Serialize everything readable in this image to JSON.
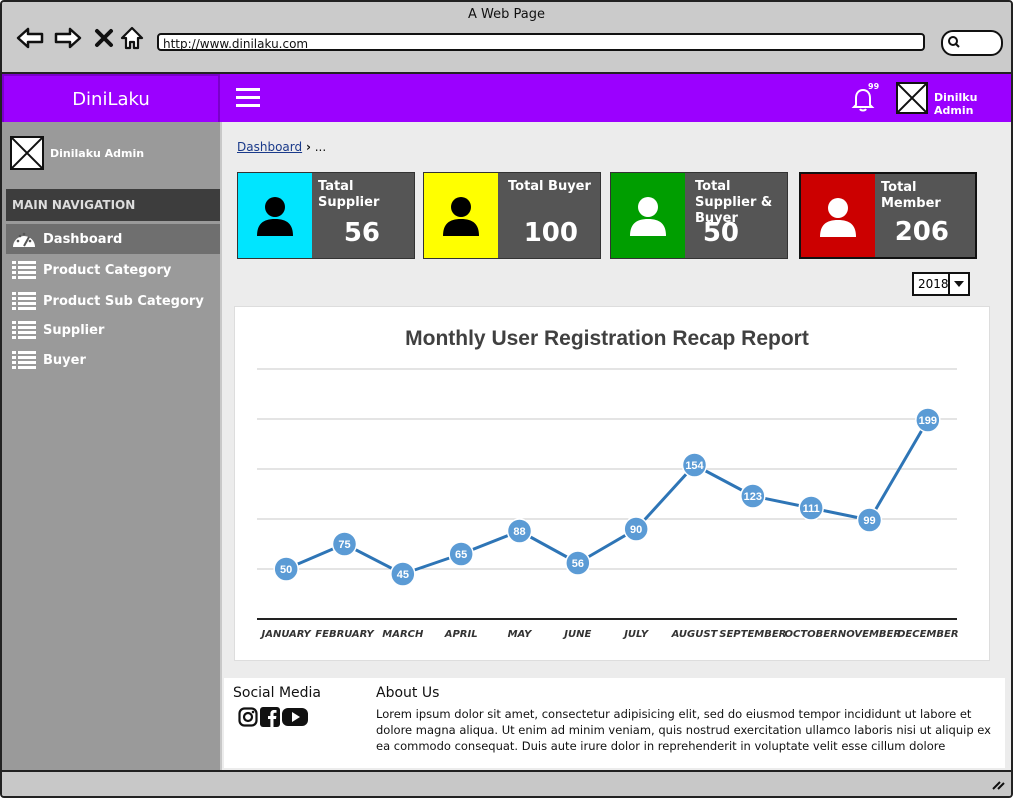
{
  "browser": {
    "window_title": "A Web Page",
    "url": "http://www.dinilaku.com"
  },
  "topbar": {
    "brand": "DiniLaku",
    "notification_count": "99",
    "user_name": "Dinilku Admin"
  },
  "sidebar": {
    "user_name": "Dinilaku Admin",
    "section_title": "MAIN NAVIGATION",
    "items": [
      {
        "label": "Dashboard",
        "icon": "dashboard-gauge-icon",
        "active": true
      },
      {
        "label": "Product Category",
        "icon": "list-icon"
      },
      {
        "label": "Product Sub Category",
        "icon": "list-icon"
      },
      {
        "label": "Supplier",
        "icon": "list-icon"
      },
      {
        "label": "Buyer",
        "icon": "list-icon"
      }
    ]
  },
  "breadcrumb": {
    "link": "Dashboard",
    "separator": "›",
    "rest": "..."
  },
  "cards": [
    {
      "label": "Tatal Supplier",
      "value": "56",
      "color": "#00e5ff",
      "icon": "user-icon",
      "icon_color": "#000000"
    },
    {
      "label": "Total Buyer",
      "value": "100",
      "color": "#ffff00",
      "icon": "user-icon",
      "icon_color": "#000000"
    },
    {
      "label": "Total Supplier & Buyer",
      "value": "50",
      "color": "#009e00",
      "icon": "user-icon",
      "icon_color": "#ffffff"
    },
    {
      "label": "Total Member",
      "value": "206",
      "color": "#cc0000",
      "icon": "user-icon",
      "icon_color": "#ffffff"
    }
  ],
  "year_select": {
    "selected": "2018"
  },
  "chart_data": {
    "type": "line",
    "title": "Monthly User Registration Recap Report",
    "categories": [
      "JANUARY",
      "FEBRUARY",
      "MARCH",
      "APRIL",
      "MAY",
      "JUNE",
      "JULY",
      "AUGUST",
      "SEPTEMBER",
      "OCTOBER",
      "NOVEMBER",
      "DECEMBER"
    ],
    "values": [
      50,
      75,
      45,
      65,
      88,
      56,
      90,
      154,
      123,
      111,
      99,
      199
    ],
    "ylim": [
      0,
      250
    ],
    "grid": true,
    "data_labels": true,
    "line_color": "#2e75b6",
    "marker_color": "#5b9bd5"
  },
  "footer": {
    "social_title": "Social Media",
    "social_icons": [
      "instagram-icon",
      "facebook-icon",
      "youtube-icon"
    ],
    "about_title": "About Us",
    "about_text": "Lorem ipsum dolor sit amet, consectetur adipisicing elit, sed do eiusmod tempor incididunt ut labore et dolore magna aliqua. Ut enim ad minim veniam, quis nostrud exercitation ullamco laboris nisi ut aliquip ex ea commodo consequat. Duis aute irure dolor in reprehenderit in voluptate velit esse cillum dolore"
  }
}
